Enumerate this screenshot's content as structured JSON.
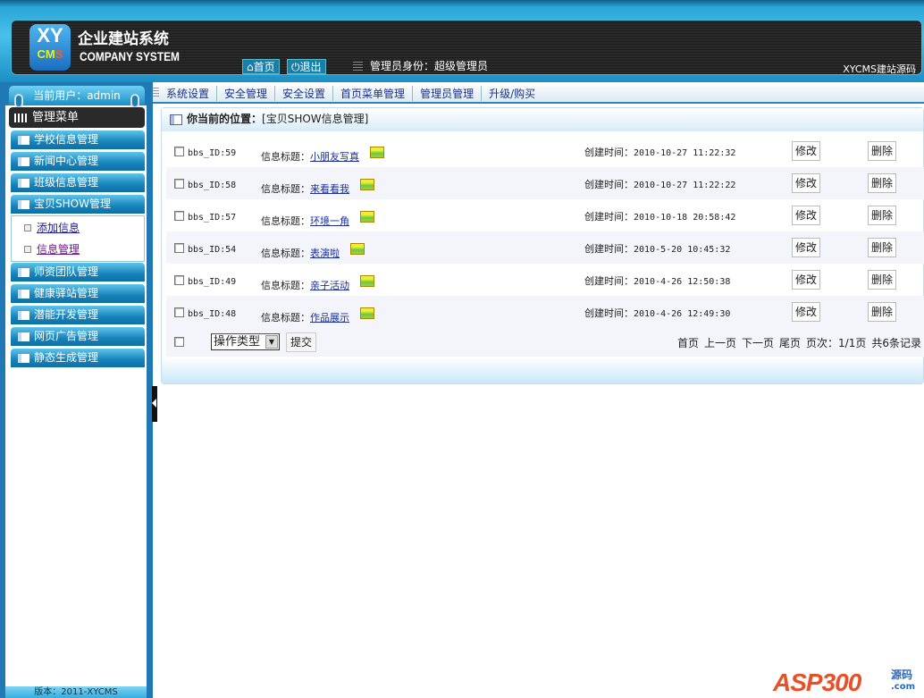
{
  "header": {
    "logo_top": "XY",
    "logo_bottom": "CMS",
    "brand_cn": "企业建站系统",
    "brand_en": "COMPANY SYSTEM",
    "home_label": "首页",
    "logout_label": "退出",
    "role_text": "管理员身份：超级管理员",
    "source_text": "XYCMS建站源码"
  },
  "nav": {
    "items": [
      "系统设置",
      "安全管理",
      "安全设置",
      "首页菜单管理",
      "管理员管理",
      "升级/购买"
    ]
  },
  "sidebar": {
    "current_user": "当前用户：admin",
    "menu_title": "管理菜单",
    "items": [
      "学校信息管理",
      "新闻中心管理",
      "班级信息管理",
      "宝贝SHOW管理",
      "师资团队管理",
      "健康驿站管理",
      "潜能开发管理",
      "网页广告管理",
      "静态生成管理"
    ],
    "submenu": [
      "添加信息",
      "信息管理"
    ],
    "version": "版本：2011-XYCMS"
  },
  "content": {
    "location_label": "你当前的位置：",
    "location_value": "[宝贝SHOW信息管理]",
    "title_label": "信息标题：",
    "time_label": "创建时间：",
    "edit_label": "修改",
    "delete_label": "删除",
    "rows": [
      {
        "id": "bbs_ID:59",
        "title": "小朋友写真",
        "time": "2010-10-27 11:22:32"
      },
      {
        "id": "bbs_ID:58",
        "title": "来看看我",
        "time": "2010-10-27 11:22:22"
      },
      {
        "id": "bbs_ID:57",
        "title": "环境一角",
        "time": "2010-10-18 20:58:42"
      },
      {
        "id": "bbs_ID:54",
        "title": "表演啦",
        "time": "2010-5-20 10:45:32"
      },
      {
        "id": "bbs_ID:49",
        "title": "亲子活动",
        "time": "2010-4-26 12:50:38"
      },
      {
        "id": "bbs_ID:48",
        "title": "作品展示",
        "time": "2010-4-26 12:49:30"
      }
    ],
    "action_select": "操作类型",
    "submit_label": "提交",
    "pager": {
      "first": "首页",
      "prev": "上一页",
      "next": "下一页",
      "last": "尾页",
      "page_info": "页次：1/1页",
      "total": "共6条记录"
    }
  },
  "watermark": {
    "text": "ASP300",
    "suffix": "源码",
    "domain": ".com"
  }
}
